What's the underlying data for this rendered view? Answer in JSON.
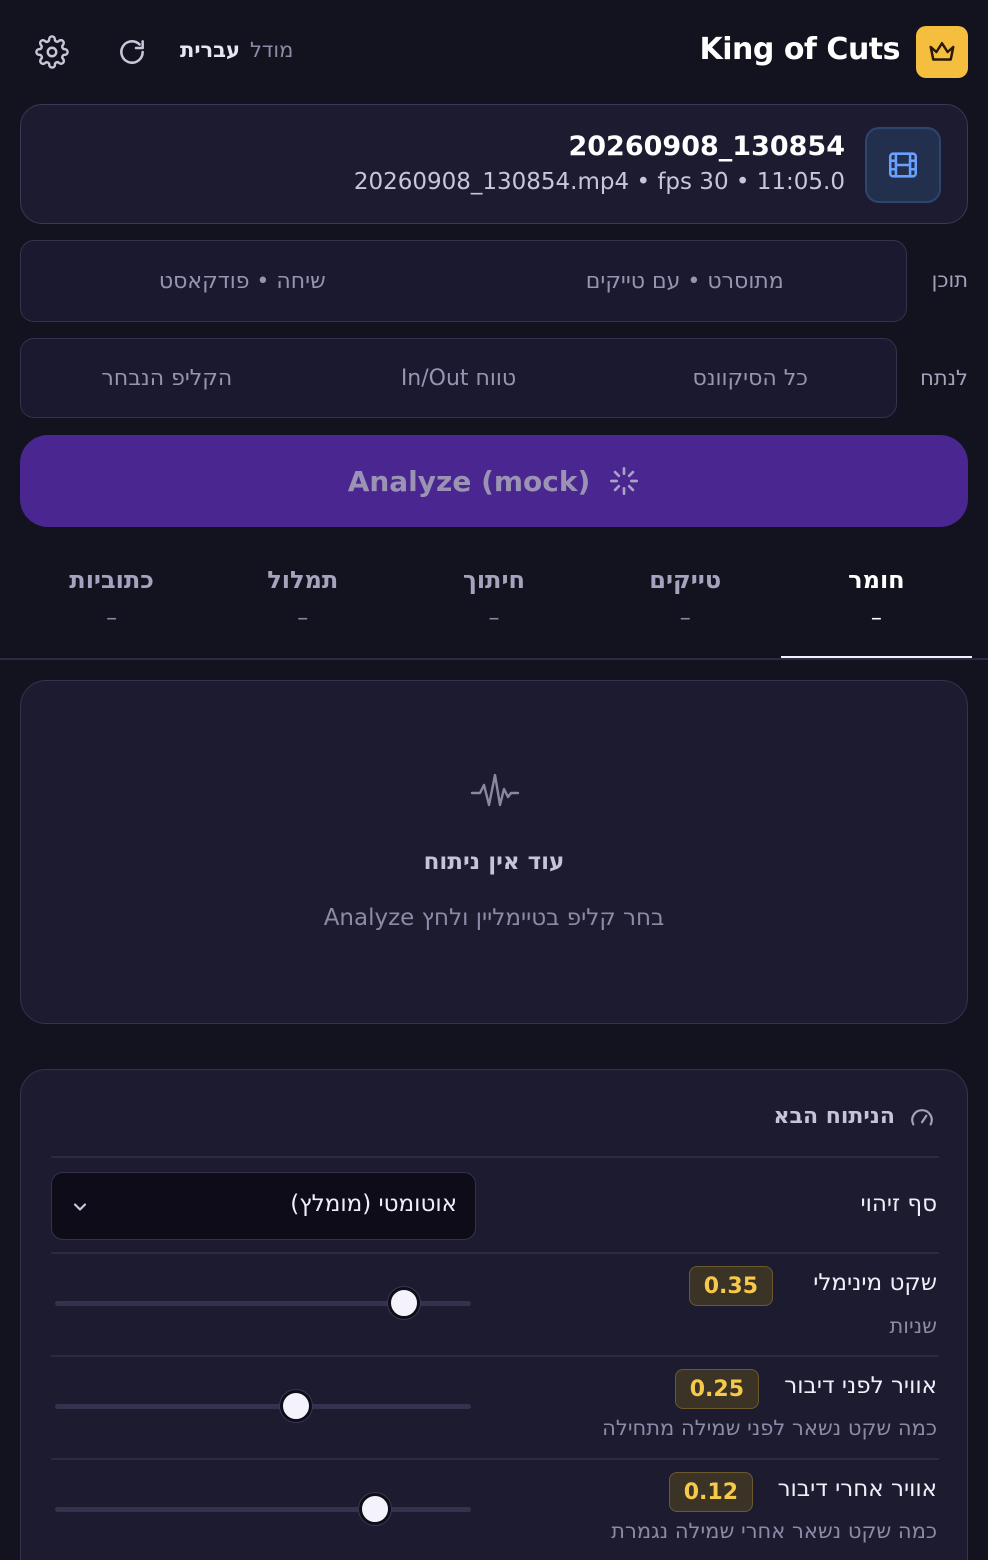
{
  "header": {
    "app_title": "King of Cuts",
    "model_label": "מודל",
    "model_value": "עברית",
    "icons": [
      "crown-icon",
      "refresh-icon",
      "gear-icon"
    ]
  },
  "file": {
    "name": "20260908_130854",
    "meta": "20260908_130854.mp4 • fps 30 • 11:05.0",
    "icon": "film-icon"
  },
  "content_row": {
    "label": "תוכן",
    "options": [
      "מתוסרט • עם טייקים",
      "שיחה • פודקאסט"
    ]
  },
  "analyze_row": {
    "label": "לנתח",
    "options": [
      "כל הסיקוונס",
      "טווח In/Out",
      "הקליפ הנבחר"
    ]
  },
  "analyze_button": {
    "label": "Analyze (mock)"
  },
  "tabs": [
    {
      "label": "חומר",
      "count": "–",
      "active": true
    },
    {
      "label": "טייקים",
      "count": "–",
      "active": false
    },
    {
      "label": "חיתוך",
      "count": "–",
      "active": false
    },
    {
      "label": "תמלול",
      "count": "–",
      "active": false
    },
    {
      "label": "כתוביות",
      "count": "–",
      "active": false
    }
  ],
  "empty_state": {
    "title": "עוד אין ניתוח",
    "subtitle": "בחר קליפ בטיימליין ולחץ Analyze",
    "icon": "waveform-icon"
  },
  "next_analysis": {
    "title": "הניתוח הבא",
    "icon": "gauge-icon",
    "threshold": {
      "label": "סף זיהוי",
      "selected": "אוטומטי (מומלץ)"
    },
    "min_silence": {
      "label": "שקט מינימלי",
      "value": "0.35",
      "hint": "שניות",
      "fill": 0.84
    },
    "pre_roll": {
      "label": "אוויר לפני דיבור",
      "value": "0.25",
      "hint": "כמה שקט נשאר לפני שמילה מתחילה",
      "fill": 0.58
    },
    "post_roll": {
      "label": "אוויר אחרי דיבור",
      "value": "0.12",
      "hint": "כמה שקט נשאר אחרי שמילה נגמרת",
      "fill": 0.77
    }
  },
  "colors": {
    "background": "#13131f",
    "card": "#1c1b30",
    "accent": "#4a2690",
    "crown": "#f5be3f",
    "badge_text": "#f7c94a"
  }
}
